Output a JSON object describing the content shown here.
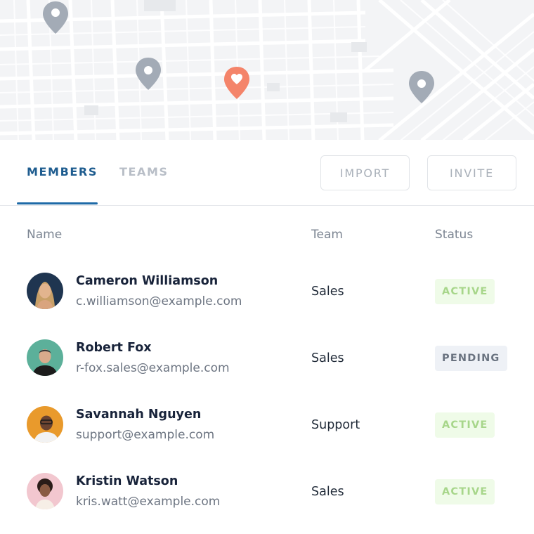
{
  "map": {
    "pins": [
      {
        "kind": "location-pin",
        "color": "#a3abb6"
      },
      {
        "kind": "location-pin",
        "color": "#a3abb6"
      },
      {
        "kind": "favorite-pin",
        "color": "#f4846a"
      },
      {
        "kind": "location-pin",
        "color": "#a3abb6"
      }
    ]
  },
  "tabs": [
    {
      "label": "MEMBERS",
      "active": true
    },
    {
      "label": "TEAMS",
      "active": false
    }
  ],
  "actions": {
    "import_label": "IMPORT",
    "invite_label": "INVITE"
  },
  "table": {
    "headers": {
      "name": "Name",
      "team": "Team",
      "status": "Status"
    },
    "rows": [
      {
        "name": "Cameron Williamson",
        "email": "c.williamson@example.com",
        "team": "Sales",
        "status": "ACTIVE"
      },
      {
        "name": "Robert Fox",
        "email": "r-fox.sales@example.com",
        "team": "Sales",
        "status": "PENDING"
      },
      {
        "name": "Savannah Nguyen",
        "email": "support@example.com",
        "team": "Support",
        "status": "ACTIVE"
      },
      {
        "name": "Kristin Watson",
        "email": "kris.watt@example.com",
        "team": "Sales",
        "status": "ACTIVE"
      }
    ]
  },
  "colors": {
    "accent": "#1e6aa7",
    "active_badge_bg": "#effbe8",
    "active_badge_text": "#a7d68a",
    "pending_badge_bg": "#eef1f6",
    "pending_badge_text": "#6a7380"
  }
}
